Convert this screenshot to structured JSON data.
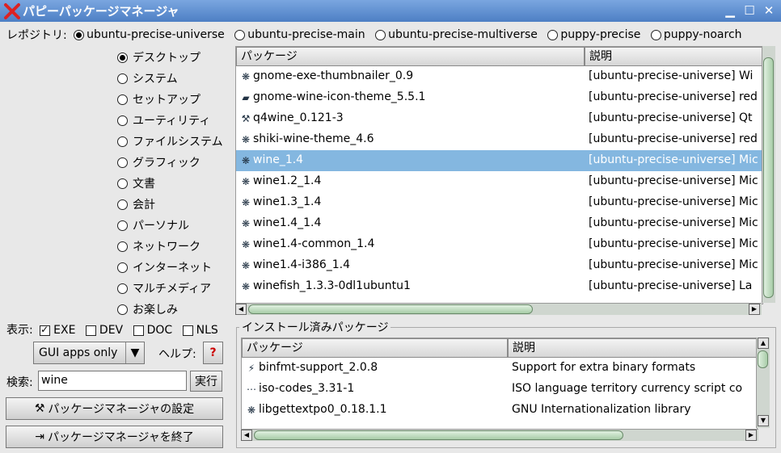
{
  "window": {
    "title": "パピーパッケージマネージャ"
  },
  "repo": {
    "label": "レポジトリ:",
    "options": [
      {
        "label": "ubuntu-precise-universe",
        "selected": true
      },
      {
        "label": "ubuntu-precise-main",
        "selected": false
      },
      {
        "label": "ubuntu-precise-multiverse",
        "selected": false
      },
      {
        "label": "puppy-precise",
        "selected": false
      },
      {
        "label": "puppy-noarch",
        "selected": false
      }
    ]
  },
  "categories": [
    {
      "label": "デスクトップ",
      "selected": true
    },
    {
      "label": "システム"
    },
    {
      "label": "セットアップ"
    },
    {
      "label": "ユーティリティ"
    },
    {
      "label": "ファイルシステム"
    },
    {
      "label": "グラフィック"
    },
    {
      "label": "文書"
    },
    {
      "label": "会計"
    },
    {
      "label": "パーソナル"
    },
    {
      "label": "ネットワーク"
    },
    {
      "label": "インターネット"
    },
    {
      "label": "マルチメディア"
    },
    {
      "label": "お楽しみ"
    }
  ],
  "packages": {
    "col_name": "パッケージ",
    "col_desc": "説明",
    "rows": [
      {
        "name": "gnome-exe-thumbnailer_0.9",
        "desc": "[ubuntu-precise-universe] Wi",
        "icon": "app-icon"
      },
      {
        "name": "gnome-wine-icon-theme_5.5.1",
        "desc": "[ubuntu-precise-universe] red",
        "icon": "theme-icon"
      },
      {
        "name": "q4wine_0.121-3",
        "desc": "[ubuntu-precise-universe] Qt",
        "icon": "tool-icon"
      },
      {
        "name": "shiki-wine-theme_4.6",
        "desc": "[ubuntu-precise-universe] red",
        "icon": "app-icon"
      },
      {
        "name": "wine_1.4",
        "desc": "[ubuntu-precise-universe] Mic",
        "icon": "app-icon",
        "selected": true
      },
      {
        "name": "wine1.2_1.4",
        "desc": "[ubuntu-precise-universe] Mic",
        "icon": "app-icon"
      },
      {
        "name": "wine1.3_1.4",
        "desc": "[ubuntu-precise-universe] Mic",
        "icon": "app-icon"
      },
      {
        "name": "wine1.4_1.4",
        "desc": "[ubuntu-precise-universe] Mic",
        "icon": "app-icon"
      },
      {
        "name": "wine1.4-common_1.4",
        "desc": "[ubuntu-precise-universe] Mic",
        "icon": "app-icon"
      },
      {
        "name": "wine1.4-i386_1.4",
        "desc": "[ubuntu-precise-universe] Mic",
        "icon": "app-icon"
      },
      {
        "name": "winefish_1.3.3-0dl1ubuntu1",
        "desc": "[ubuntu-precise-universe] La",
        "icon": "app-icon"
      }
    ]
  },
  "show": {
    "label": "表示:",
    "options": [
      {
        "label": "EXE",
        "checked": true
      },
      {
        "label": "DEV",
        "checked": false
      },
      {
        "label": "DOC",
        "checked": false
      },
      {
        "label": "NLS",
        "checked": false
      }
    ]
  },
  "filter_combo": {
    "value": "GUI apps only"
  },
  "help": {
    "label": "ヘルプ:",
    "icon_glyph": "?"
  },
  "search": {
    "label": "検索:",
    "value": "wine",
    "button": "実行"
  },
  "settings_button": "パッケージマネージャの設定",
  "quit_button": "パッケージマネージャを終了",
  "installed": {
    "frame_label": "インストール済みパッケージ",
    "col_name": "パッケージ",
    "col_desc": "説明",
    "rows": [
      {
        "name": "binfmt-support_2.0.8",
        "desc": "Support for extra binary formats",
        "icon": "wand-icon"
      },
      {
        "name": "iso-codes_3.31-1",
        "desc": "ISO language territory currency script co",
        "icon": "dots-icon"
      },
      {
        "name": "libgettextpo0_0.18.1.1",
        "desc": "GNU Internationalization library",
        "icon": "app-icon"
      }
    ]
  },
  "colors": {
    "titlebar": "#5a8ad0",
    "selection": "#84b7e0",
    "scroll_thumb": "#a8cca8"
  }
}
